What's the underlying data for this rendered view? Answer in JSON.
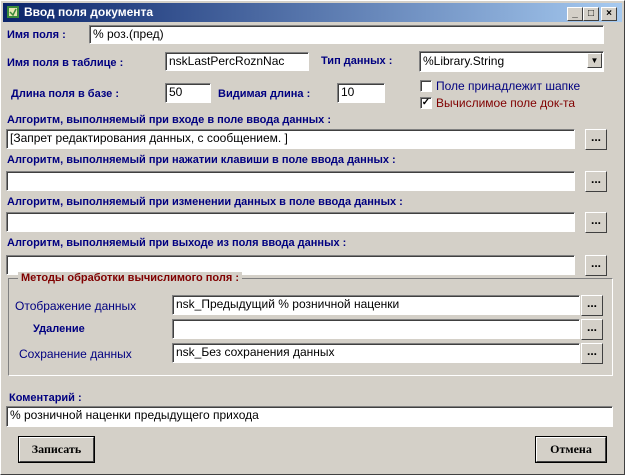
{
  "window": {
    "title": "Ввод поля документа",
    "minimize": "_",
    "maximize": "□",
    "close": "×"
  },
  "fields": {
    "field_name_label": "Имя поля :",
    "field_name_value": "% роз.(пред)",
    "table_name_label": "Имя поля в таблице :",
    "table_name_value": "nskLastPercRoznNac",
    "data_type_label": "Тип данных :",
    "data_type_value": "%Library.String",
    "db_length_label": "Длина поля в базе :",
    "db_length_value": "50",
    "visible_length_label": "Видимая длина :",
    "visible_length_value": "10",
    "header_field_label": "Поле принадлежит шапке",
    "header_field_checked": false,
    "calculated_label": "Вычислимое поле док-та",
    "calculated_checked": true
  },
  "algorithms": {
    "on_enter_label": "Алгоритм, выполняемый при входе в поле ввода данных :",
    "on_enter_value": "[Запрет редактирования  данных, с сообщением. ]",
    "on_keypress_label": "Алгоритм, выполняемый при нажатии клавиши в поле ввода данных :",
    "on_keypress_value": "",
    "on_change_label": "Алгоритм, выполняемый при изменении данных в поле ввода данных :",
    "on_change_value": "",
    "on_exit_label": "Алгоритм, выполняемый при выходе из поля ввода данных :",
    "on_exit_value": "",
    "dots": "..."
  },
  "methods": {
    "group_title": "Методы обработки вычислимого поля :",
    "display_label": "Отображение данных",
    "display_value": "nsk_Предыдущий % розничной наценки",
    "delete_label": "Удаление",
    "delete_value": "",
    "save_label": "Сохранение данных",
    "save_value": "nsk_Без сохранения данных"
  },
  "comment": {
    "label": "Коментарий :",
    "value": "% розничной наценки предыдущего прихода"
  },
  "buttons": {
    "save": "Записать",
    "cancel": "Отмена"
  },
  "colors": {
    "label_blue": "#000080",
    "label_red": "#800000",
    "title_start": "#0a246a",
    "title_end": "#a6caf0"
  }
}
